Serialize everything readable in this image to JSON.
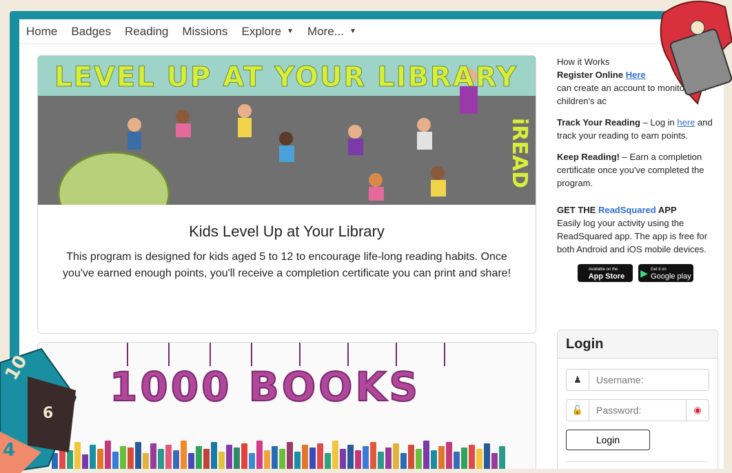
{
  "nav": {
    "items": [
      "Home",
      "Badges",
      "Reading",
      "Missions",
      "Explore",
      "More..."
    ]
  },
  "card1": {
    "banner_title": "LEVEL UP AT YOUR LIBRARY",
    "banner_side_text": "iREAD",
    "title": "Kids Level Up at Your Library",
    "text": "This program is designed for kids aged 5 to 12 to encourage life-long reading habits. Once you've earned enough points, you'll receive a completion certificate you can print and share!"
  },
  "card2": {
    "banner_title": "1000 BOOKS"
  },
  "sidebar": {
    "how_it_works": "How it Works",
    "register_label": "Register Online",
    "register_link": "Here",
    "register_text": "can create an account to monitor your children's ac",
    "track_label": "Track Your Reading",
    "track_pre": " – Log in ",
    "track_link": "here",
    "track_post": " and track your reading to earn points.",
    "keep_label": "Keep Reading!",
    "keep_text": " – Earn a completion certificate once you've completed the program.",
    "app_pre": "GET THE ",
    "app_name": "ReadSquared",
    "app_post": " APP",
    "app_text": "Easily log your activity using the ReadSquared app. The app is free for both Android and iOS mobile devices.",
    "appstore_small": "Available on the",
    "appstore_big": "App Store",
    "googleplay_small": "Get it on",
    "googleplay_big": "Google play"
  },
  "login": {
    "title": "Login",
    "username_placeholder": "Username:",
    "password_placeholder": "Password:",
    "button": "Login"
  },
  "colors": {
    "frame": "#1a8fa1",
    "link": "#2f6fd6",
    "banner_yellow": "#d7ef3a",
    "books_purple": "#b0479a"
  }
}
